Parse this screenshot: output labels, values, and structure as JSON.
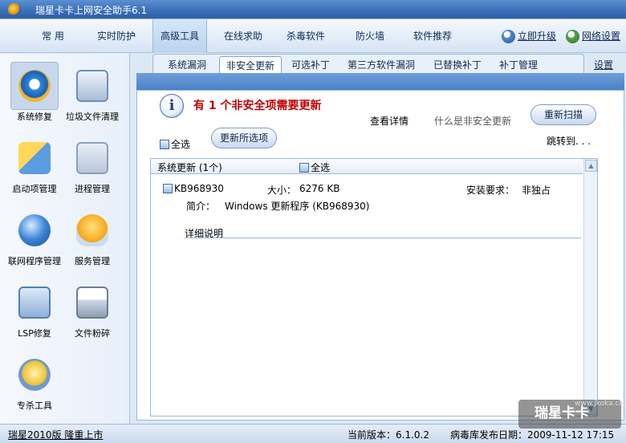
{
  "window": {
    "title": "瑞星卡卡上网安全助手6.1"
  },
  "menu": {
    "items": [
      "常 用",
      "实时防护",
      "高级工具",
      "在线求助",
      "杀毒软件",
      "防火墙",
      "软件推荐"
    ],
    "active_index": 2,
    "upgrade_label": "立即升级",
    "network_label": "网络设置"
  },
  "sidebar": {
    "items": [
      {
        "label": "系统修复",
        "icon": "ie-repair-icon"
      },
      {
        "label": "垃圾文件清理",
        "icon": "trash-icon"
      },
      {
        "label": "启动项管理",
        "icon": "startup-icon"
      },
      {
        "label": "进程管理",
        "icon": "process-gear-icon"
      },
      {
        "label": "联网程序管理",
        "icon": "globe-icon"
      },
      {
        "label": "服务管理",
        "icon": "heart-icon"
      },
      {
        "label": "LSP修复",
        "icon": "lsp-icon"
      },
      {
        "label": "文件粉碎",
        "icon": "shredder-icon"
      },
      {
        "label": "专杀工具",
        "icon": "kill-tool-icon"
      }
    ]
  },
  "subtabs": {
    "items": [
      "系统漏洞",
      "非安全更新",
      "可选补丁",
      "第三方软件漏洞",
      "已替换补丁",
      "补丁管理"
    ],
    "active_index": 1,
    "settings_label": "设置"
  },
  "panel": {
    "headline": "有  1  个非安全项需要更新",
    "view_details": "查看详情",
    "what_is": "什么是非安全更新",
    "rescan_button": "重新扫描",
    "select_all": "全选",
    "update_selected_button": "更新所选项",
    "jump_to": "跳转到. . ."
  },
  "list": {
    "group_title": "系统更新 (1个)",
    "group_select_all": "全选",
    "entry": {
      "id": "KB968930",
      "size_label": "大小：",
      "size": "6276 KB",
      "install_label": "安装要求：",
      "install_value": "非独占",
      "desc_label": "简介：",
      "desc": "Windows 更新程序 (KB968930)",
      "detail_link": "详细说明"
    }
  },
  "statusbar": {
    "promo": "瑞星2010版 隆重上市",
    "version": "当前版本：6.1.0.2",
    "db_date": "病毒库发布日期：2009-11-12 17:15"
  },
  "watermark": {
    "main": "瑞星卡卡",
    "sub": "www.jkoka.com"
  }
}
